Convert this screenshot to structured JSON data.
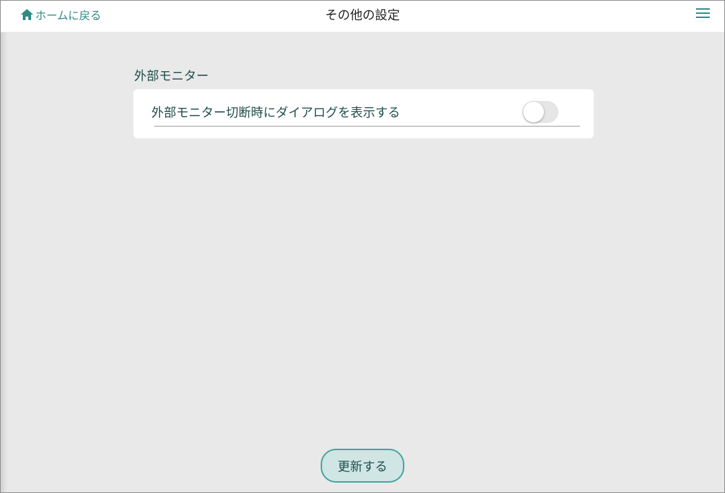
{
  "header": {
    "back_label": "ホームに戻る",
    "title": "その他の設定",
    "home_icon": "home-icon",
    "menu_icon": "hamburger-menu-icon"
  },
  "section": {
    "label": "外部モニター",
    "rows": [
      {
        "label": "外部モニター切断時にダイアログを表示する",
        "toggle_on": false
      }
    ]
  },
  "footer": {
    "update_label": "更新する"
  },
  "colors": {
    "accent": "#2f8a84",
    "text_dark_green": "#1f4f4b",
    "background": "#e9e9e9",
    "button_fill": "#cfe6e4",
    "button_border": "#3fa59c"
  }
}
